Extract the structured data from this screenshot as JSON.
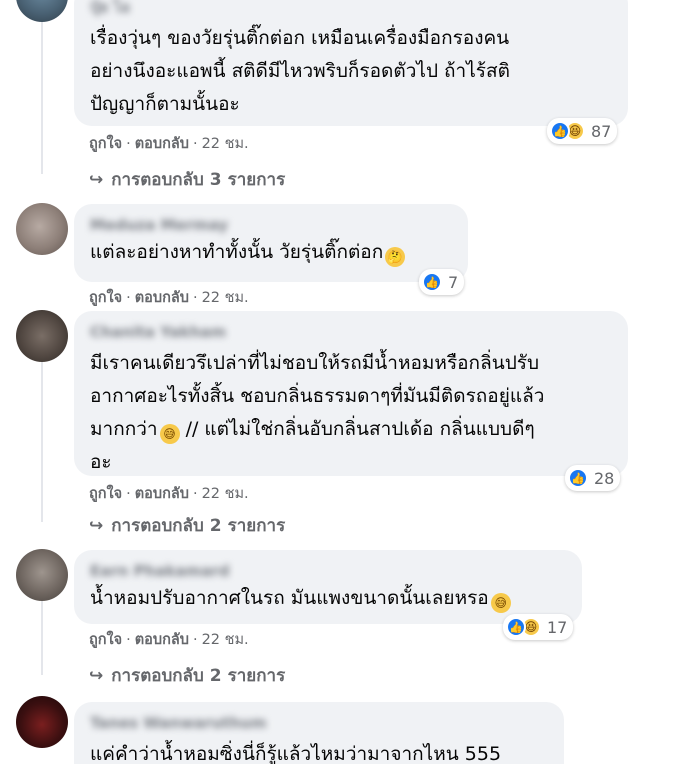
{
  "comments": [
    {
      "author": "ปุ๋ย ไอ",
      "lines": [
        "เรื่องวุ่นๆ ของวัยรุ่นติ๊กต่อก เหมือนเครื่องมือกรองคน",
        "อย่างนึงอะแอพนี้ สติดีมีไหวพริบก็รอดตัวไป ถ้าไร้สติ",
        "ปัญญาก็ตามนั้นอะ"
      ],
      "emoji": "",
      "reaction_icons": [
        "like-icon",
        "haha-icon"
      ],
      "reaction_count": "87",
      "like_label": "ถูกใจ",
      "reply_label": "ตอบกลับ",
      "time": "22 ชม.",
      "replies_label": "การตอบกลับ",
      "replies_count": "3",
      "replies_unit": "รายการ"
    },
    {
      "author": "Meduza Mermay",
      "lines": [
        "แต่ละอย่างหาทำทั้งนั้น วัยรุ่นติ๊กต่อก"
      ],
      "emoji": "thinking-face-emoji",
      "reaction_icons": [
        "like-icon"
      ],
      "reaction_count": "7",
      "like_label": "ถูกใจ",
      "reply_label": "ตอบกลับ",
      "time": "22 ชม."
    },
    {
      "author": "Chanita Yakham",
      "lines": [
        "มีเราคนเดียวรึเปล่าที่ไม่ชอบให้รถมีน้ำหอมหรือกลิ่นปรับ",
        "อากาศอะไรทั้งสิ้น ชอบกลิ่นธรรมดาๆที่มันมีติดรถอยู่แล้ว",
        "มากกว่า",
        " // แต่ไม่ใช่กลิ่นอับกลิ่นสาปเด้อ กลิ่นแบบดีๆ",
        "อะ"
      ],
      "emoji": "sweat-smile-emoji",
      "reaction_icons": [
        "like-icon"
      ],
      "reaction_count": "28",
      "like_label": "ถูกใจ",
      "reply_label": "ตอบกลับ",
      "time": "22 ชม.",
      "replies_label": "การตอบกลับ",
      "replies_count": "2",
      "replies_unit": "รายการ"
    },
    {
      "author": "Earn Phakamard",
      "lines": [
        "น้ำหอมปรับอากาศในรถ มันแพงขนาดนั้นเลยหรอ"
      ],
      "emoji": "sweat-smile-emoji",
      "reaction_icons": [
        "like-icon",
        "haha-icon"
      ],
      "reaction_count": "17",
      "like_label": "ถูกใจ",
      "reply_label": "ตอบกลับ",
      "time": "22 ชม.",
      "replies_label": "การตอบกลับ",
      "replies_count": "2",
      "replies_unit": "รายการ"
    },
    {
      "author": "Tanes Wanwaruthum",
      "lines": [
        "แค่คำว่าน้ำหอมซิ่งนี่ก็รู้แล้วไหมว่ามาจากไหน 555"
      ]
    }
  ],
  "colors": {
    "bubble": "#f0f2f5",
    "meta_text": "#65676b",
    "like_blue": "#1877f2",
    "haha_yellow": "#f7c94a"
  }
}
